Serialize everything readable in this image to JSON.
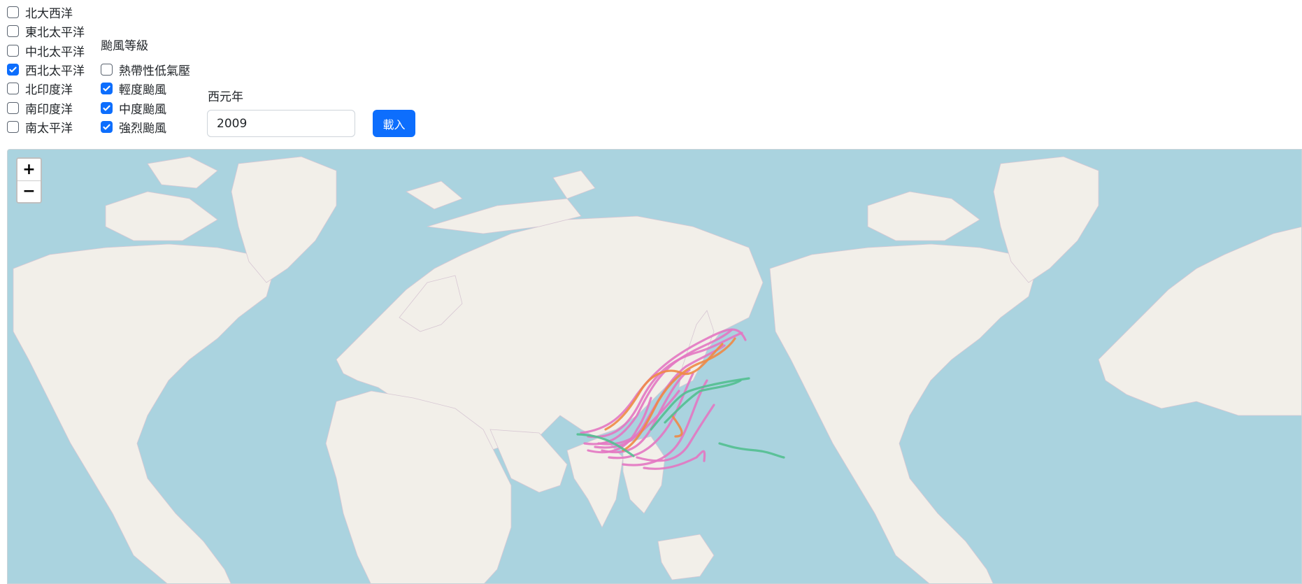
{
  "basins": [
    {
      "label": "北大西洋",
      "checked": false
    },
    {
      "label": "東北太平洋",
      "checked": false
    },
    {
      "label": "中北太平洋",
      "checked": false
    },
    {
      "label": "西北太平洋",
      "checked": true
    },
    {
      "label": "北印度洋",
      "checked": false
    },
    {
      "label": "南印度洋",
      "checked": false
    },
    {
      "label": "南太平洋",
      "checked": false
    }
  ],
  "grades": {
    "title": "颱風等級",
    "items": [
      {
        "label": "熱帶性低氣壓",
        "checked": false
      },
      {
        "label": "輕度颱風",
        "checked": true
      },
      {
        "label": "中度颱風",
        "checked": true
      },
      {
        "label": "強烈颱風",
        "checked": true
      }
    ]
  },
  "year": {
    "label": "西元年",
    "value": "2009"
  },
  "load_button": "載入",
  "map": {
    "zoom_in": "+",
    "zoom_out": "−",
    "colors": {
      "ocean": "#aad3df",
      "land": "#f2efe9",
      "track_pink": "#e377c2",
      "track_orange": "#ee8a45",
      "track_green": "#52bf90"
    }
  }
}
